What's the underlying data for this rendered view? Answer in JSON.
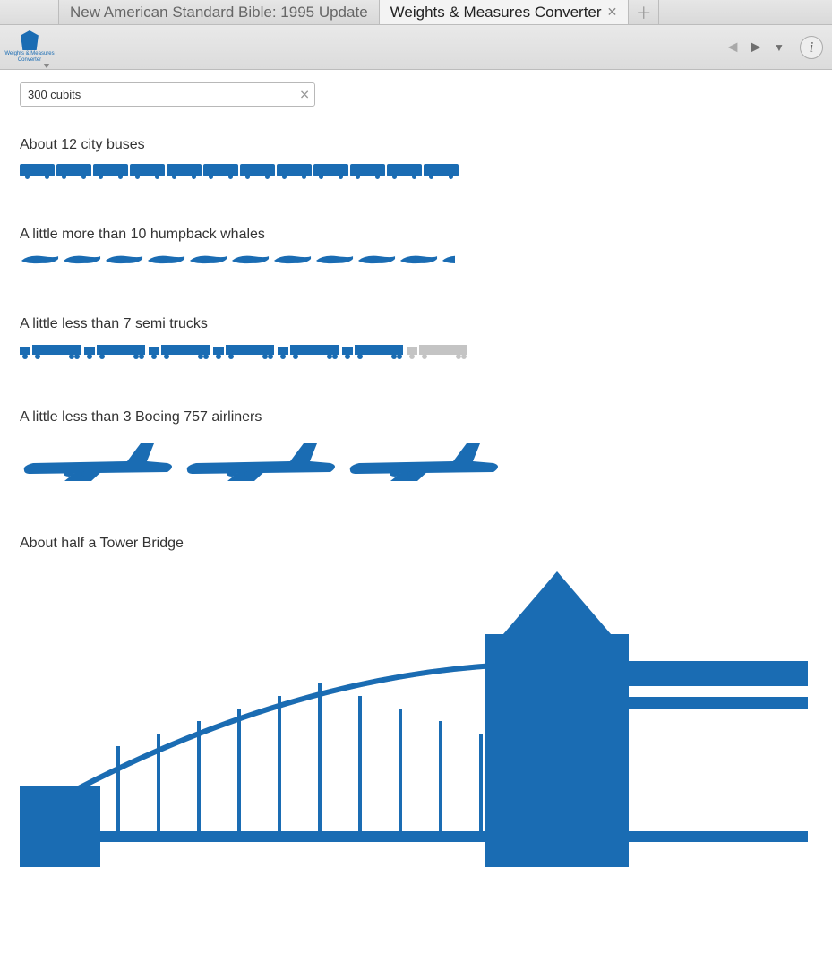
{
  "tabs": {
    "inactive": "New American Standard Bible: 1995 Update",
    "active": "Weights & Measures Converter"
  },
  "panel_icon_caption": "Weights & Measures Converter",
  "search": {
    "value": "300 cubits"
  },
  "colors": {
    "brand": "#1a6cb3",
    "ghost": "#c6c6c6"
  },
  "comparisons": [
    {
      "label": "About 12 city buses",
      "icon": "bus",
      "count": 12,
      "last_fraction": 1.0
    },
    {
      "label": "A little more than 10 humpback whales",
      "icon": "whale",
      "count": 11,
      "last_fraction": 0.35
    },
    {
      "label": "A little less than 7 semi trucks",
      "icon": "truck",
      "count": 7,
      "last_fraction": 0.55,
      "ghost_last": true
    },
    {
      "label": "A little less than 3 Boeing 757 airliners",
      "icon": "plane",
      "count": 3,
      "last_fraction": 1.0
    },
    {
      "label": "About half a Tower Bridge",
      "icon": "bridge",
      "count": 1,
      "last_fraction": 0.5
    }
  ]
}
